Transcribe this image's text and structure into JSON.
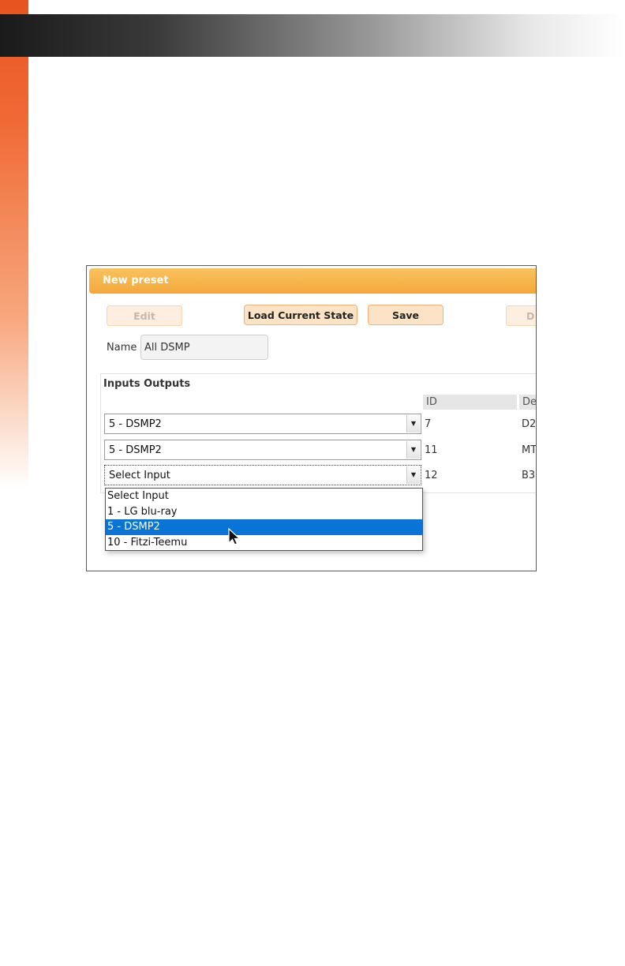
{
  "panel": {
    "title": "New preset",
    "buttons": {
      "edit": "Edit",
      "load_current_state": "Load Current State",
      "save": "Save",
      "delete_partial": "D"
    },
    "name_label": "Name",
    "name_value": "All DSMP"
  },
  "section": {
    "title": "Inputs Outputs",
    "columns": {
      "id": "ID",
      "desc_partial": "De"
    },
    "rows": [
      {
        "input": "5 - DSMP2",
        "id": "7",
        "desc": "D2"
      },
      {
        "input": "5 - DSMP2",
        "id": "11",
        "desc": "MT"
      },
      {
        "input": "Select Input",
        "id": "12",
        "desc": "B3"
      }
    ]
  },
  "dropdown": {
    "options": [
      "Select Input",
      "1 - LG blu-ray",
      "5 - DSMP2",
      "10 - Fitzi-Teemu"
    ],
    "highlighted": "5 - DSMP2"
  },
  "colors": {
    "accent_orange": "#f4a73a",
    "selection_blue": "#0a74d6"
  }
}
